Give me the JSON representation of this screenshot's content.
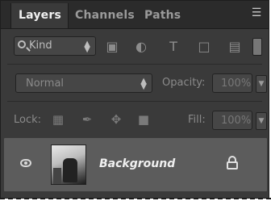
{
  "tabs": [
    {
      "label": "Layers",
      "active": true
    },
    {
      "label": "Channels",
      "active": false
    },
    {
      "label": "Paths",
      "active": false
    }
  ],
  "panel_menu_icon": "panel-menu-icon",
  "filter": {
    "kind_label": "Kind",
    "icons": [
      "pixel-layer-filter-icon",
      "adjustment-filter-icon",
      "type-filter-icon",
      "shape-filter-icon",
      "smart-object-filter-icon"
    ]
  },
  "blend": {
    "mode": "Normal",
    "opacity_label": "Opacity:",
    "opacity_value": "100%"
  },
  "lock": {
    "label": "Lock:",
    "icons": [
      "lock-transparent-icon",
      "lock-image-icon",
      "lock-position-icon",
      "lock-all-icon"
    ],
    "fill_label": "Fill:",
    "fill_value": "100%"
  },
  "layers": [
    {
      "name": "Background",
      "visible": true,
      "locked": true
    }
  ],
  "colors": {
    "panel_bg": "#3a3a3a",
    "tabbar_bg": "#2b2b2b",
    "selected_layer_bg": "#5c5c5c"
  }
}
